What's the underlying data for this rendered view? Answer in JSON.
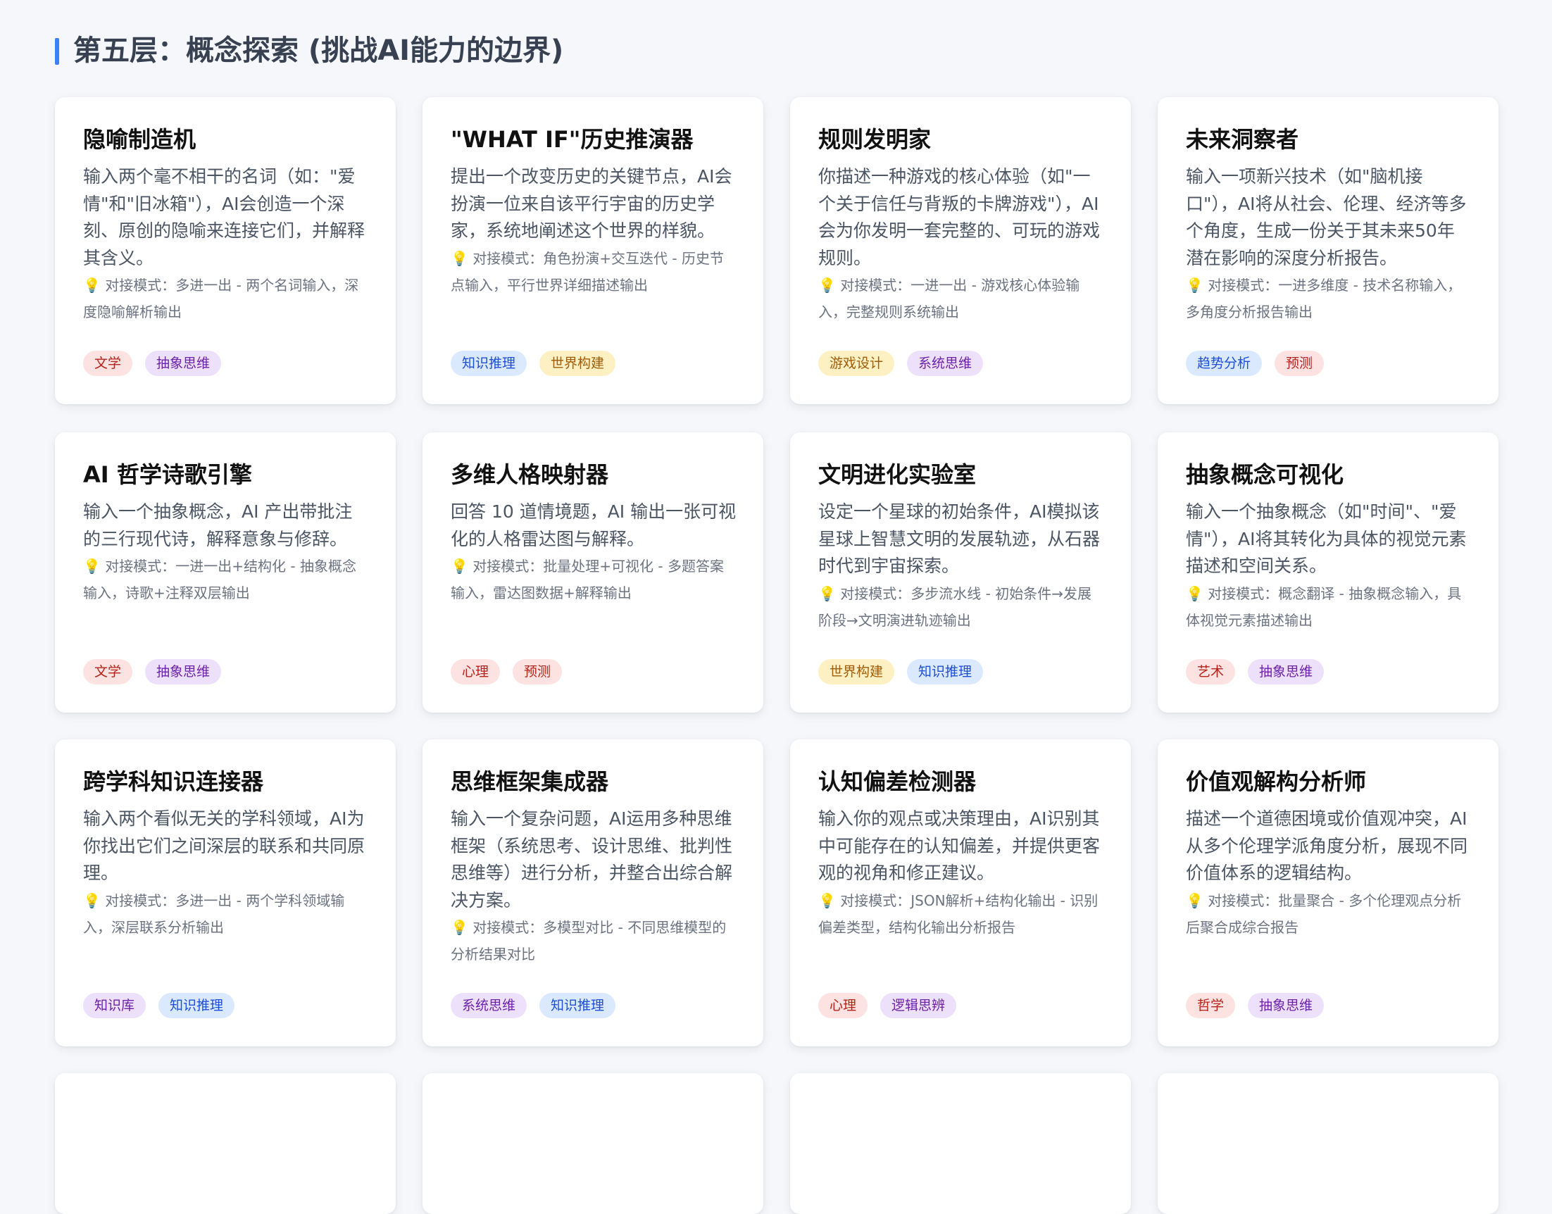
{
  "section": {
    "title": "第五层：概念探索 (挑战AI能力的边界)"
  },
  "colors": {
    "accent_bar": "#3b82f6",
    "tag_red": "#fde2e2",
    "tag_purple": "#ede0fb",
    "tag_blue": "#dbe9fe",
    "tag_yellow": "#fdf1c4"
  },
  "cards": [
    {
      "title": "隐喻制造机",
      "desc": "输入两个毫不相干的名词（如：\"爱情\"和\"旧冰箱\"），AI会创造一个深刻、原创的隐喻来连接它们，并解释其含义。",
      "mode": "对接模式：多进一出 - 两个名词输入，深度隐喻解析输出",
      "tags": [
        {
          "label": "文学",
          "color": "red"
        },
        {
          "label": "抽象思维",
          "color": "purple"
        }
      ]
    },
    {
      "title": "\"WHAT IF\"历史推演器",
      "desc": "提出一个改变历史的关键节点，AI会扮演一位来自该平行宇宙的历史学家，系统地阐述这个世界的样貌。",
      "mode": "对接模式：角色扮演+交互迭代 - 历史节点输入，平行世界详细描述输出",
      "tags": [
        {
          "label": "知识推理",
          "color": "blue"
        },
        {
          "label": "世界构建",
          "color": "yellow"
        }
      ]
    },
    {
      "title": "规则发明家",
      "desc": "你描述一种游戏的核心体验（如\"一个关于信任与背叛的卡牌游戏\"），AI会为你发明一套完整的、可玩的游戏规则。",
      "mode": "对接模式：一进一出 - 游戏核心体验输入，完整规则系统输出",
      "tags": [
        {
          "label": "游戏设计",
          "color": "yellow"
        },
        {
          "label": "系统思维",
          "color": "purple"
        }
      ]
    },
    {
      "title": "未来洞察者",
      "desc": "输入一项新兴技术（如\"脑机接口\"），AI将从社会、伦理、经济等多个角度，生成一份关于其未来50年潜在影响的深度分析报告。",
      "mode": "对接模式：一进多维度 - 技术名称输入，多角度分析报告输出",
      "tags": [
        {
          "label": "趋势分析",
          "color": "blue"
        },
        {
          "label": "预测",
          "color": "red"
        }
      ]
    },
    {
      "title": "AI 哲学诗歌引擎",
      "desc": "输入一个抽象概念，AI 产出带批注的三行现代诗，解释意象与修辞。",
      "mode": "对接模式：一进一出+结构化 - 抽象概念输入，诗歌+注释双层输出",
      "tags": [
        {
          "label": "文学",
          "color": "red"
        },
        {
          "label": "抽象思维",
          "color": "purple"
        }
      ]
    },
    {
      "title": "多维人格映射器",
      "desc": "回答 10 道情境题，AI 输出一张可视化的人格雷达图与解释。",
      "mode": "对接模式：批量处理+可视化 - 多题答案输入，雷达图数据+解释输出",
      "tags": [
        {
          "label": "心理",
          "color": "red"
        },
        {
          "label": "预测",
          "color": "red"
        }
      ]
    },
    {
      "title": "文明进化实验室",
      "desc": "设定一个星球的初始条件，AI模拟该星球上智慧文明的发展轨迹，从石器时代到宇宙探索。",
      "mode": "对接模式：多步流水线 - 初始条件→发展阶段→文明演进轨迹输出",
      "tags": [
        {
          "label": "世界构建",
          "color": "yellow"
        },
        {
          "label": "知识推理",
          "color": "blue"
        }
      ]
    },
    {
      "title": "抽象概念可视化",
      "desc": "输入一个抽象概念（如\"时间\"、\"爱情\"），AI将其转化为具体的视觉元素描述和空间关系。",
      "mode": "对接模式：概念翻译 - 抽象概念输入，具体视觉元素描述输出",
      "tags": [
        {
          "label": "艺术",
          "color": "red"
        },
        {
          "label": "抽象思维",
          "color": "purple"
        }
      ]
    },
    {
      "title": "跨学科知识连接器",
      "desc": "输入两个看似无关的学科领域，AI为你找出它们之间深层的联系和共同原理。",
      "mode": "对接模式：多进一出 - 两个学科领域输入，深层联系分析输出",
      "tags": [
        {
          "label": "知识库",
          "color": "purple"
        },
        {
          "label": "知识推理",
          "color": "blue"
        }
      ]
    },
    {
      "title": "思维框架集成器",
      "desc": "输入一个复杂问题，AI运用多种思维框架（系统思考、设计思维、批判性思维等）进行分析，并整合出综合解决方案。",
      "mode": "对接模式：多模型对比 - 不同思维模型的分析结果对比",
      "tags": [
        {
          "label": "系统思维",
          "color": "purple"
        },
        {
          "label": "知识推理",
          "color": "blue"
        }
      ]
    },
    {
      "title": "认知偏差检测器",
      "desc": "输入你的观点或决策理由，AI识别其中可能存在的认知偏差，并提供更客观的视角和修正建议。",
      "mode": "对接模式：JSON解析+结构化输出 - 识别偏差类型，结构化输出分析报告",
      "tags": [
        {
          "label": "心理",
          "color": "red"
        },
        {
          "label": "逻辑思辨",
          "color": "purple"
        }
      ]
    },
    {
      "title": "价值观解构分析师",
      "desc": "描述一个道德困境或价值观冲突，AI从多个伦理学派角度分析，展现不同价值体系的逻辑结构。",
      "mode": "对接模式：批量聚合 - 多个伦理观点分析后聚合成综合报告",
      "tags": [
        {
          "label": "哲学",
          "color": "red"
        },
        {
          "label": "抽象思维",
          "color": "purple"
        }
      ]
    }
  ]
}
